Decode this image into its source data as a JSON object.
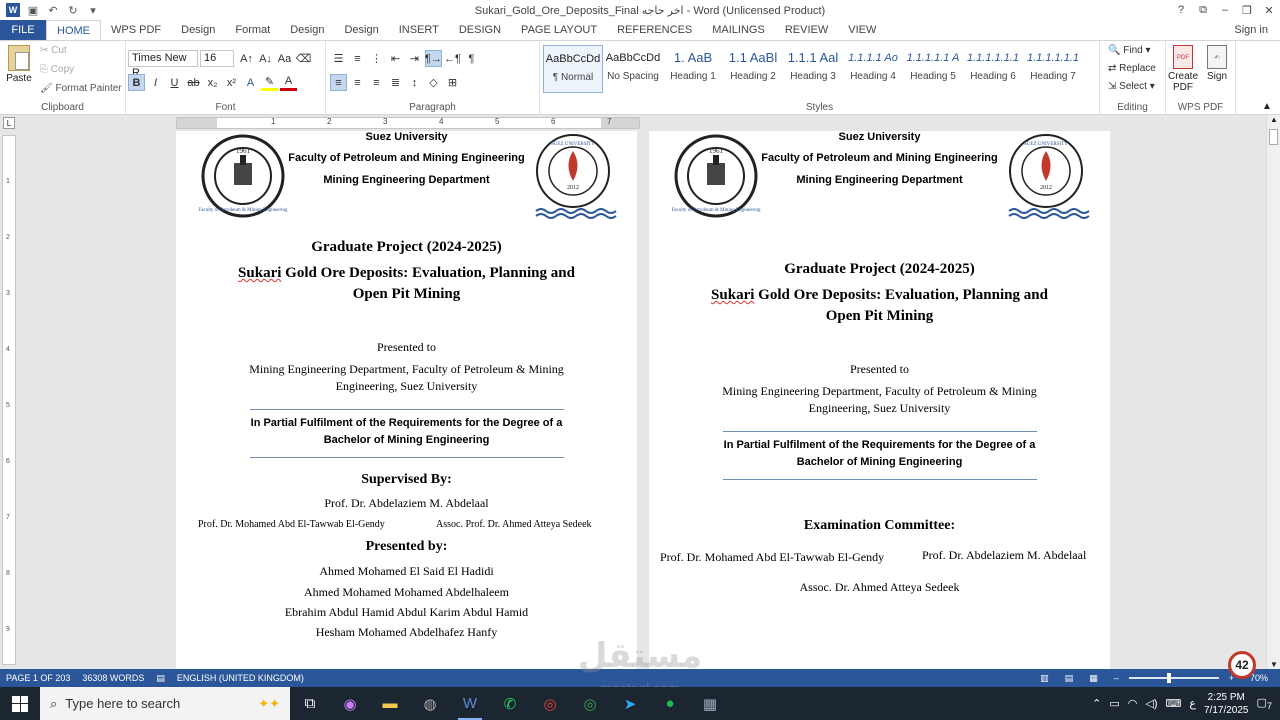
{
  "window": {
    "title": "Sukari_Gold_Ore_Deposits_Final اخر حاجه - Word (Unlicensed Product)",
    "controls": [
      "?",
      "⧉",
      "–",
      "❐",
      "✕"
    ]
  },
  "qat": {
    "save_icon": "save-icon",
    "undo_icon": "undo-icon",
    "redo_icon": "redo-icon"
  },
  "tabs": [
    "FILE",
    "HOME",
    "WPS PDF",
    "Design",
    "Format",
    "Design",
    "Design",
    "INSERT",
    "DESIGN",
    "PAGE LAYOUT",
    "REFERENCES",
    "MAILINGS",
    "REVIEW",
    "VIEW"
  ],
  "active_tab": "HOME",
  "signin": "Sign in",
  "clipboard": {
    "paste": "Paste",
    "cut": "Cut",
    "copy": "Copy",
    "format_painter": "Format Painter",
    "label": "Clipboard"
  },
  "font": {
    "name": "Times New R",
    "size": "16",
    "label": "Font"
  },
  "paragraph": {
    "label": "Paragraph"
  },
  "styles": {
    "label": "Styles",
    "items": [
      {
        "sample": "AaBbCcDd",
        "name": "¶ Normal"
      },
      {
        "sample": "AaBbCcDd",
        "name": "No Spacing"
      },
      {
        "sample": "1. AaB",
        "name": "Heading 1"
      },
      {
        "sample": "1.1 AaBl",
        "name": "Heading 2"
      },
      {
        "sample": "1.1.1 Aal",
        "name": "Heading 3"
      },
      {
        "sample": "1.1.1.1 Ao",
        "name": "Heading 4"
      },
      {
        "sample": "1.1.1.1.1 A",
        "name": "Heading 5"
      },
      {
        "sample": "1.1.1.1.1.1",
        "name": "Heading 6"
      },
      {
        "sample": "1.1.1.1.1.1",
        "name": "Heading 7"
      }
    ]
  },
  "editing": {
    "find": "Find",
    "replace": "Replace",
    "select": "Select",
    "label": "Editing"
  },
  "wps": {
    "create_pdf_1": "Create",
    "create_pdf_2": "PDF",
    "sign": "Sign",
    "label": "WPS PDF"
  },
  "ruler": {
    "numbers": [
      "1",
      "2",
      "3",
      "4",
      "5",
      "6",
      "7"
    ],
    "vnumbers": [
      "1",
      "2",
      "3",
      "4",
      "5",
      "6",
      "7",
      "8",
      "9"
    ]
  },
  "page1": {
    "univ": "Suez University",
    "faculty": "Faculty of Petroleum and Mining Engineering",
    "dept": "Mining Engineering Department",
    "project": "Graduate Project (2024-2025)",
    "title_sukari": "Sukari",
    "title_rest1": " Gold Ore Deposits: Evaluation, Planning and",
    "title_line2": "Open Pit Mining",
    "presented_to": "Presented to",
    "pt1": "Mining Engineering Department, Faculty of Petroleum & Mining",
    "pt2": "Engineering, Suez University",
    "fulfil1": "In Partial Fulfilment of the Requirements for the Degree of a",
    "fulfil2": "Bachelor of Mining Engineering",
    "supervised": "Supervised By:",
    "sup1": "Prof. Dr. Abdelaziem M. Abdelaal",
    "sup2": "Prof. Dr. Mohamed Abd El-Tawwab El-Gendy",
    "sup3": "Assoc. Prof. Dr. Ahmed Atteya Sedeek",
    "presented_by": "Presented by:",
    "students": [
      "Ahmed Mohamed El Said El Hadidi",
      "Ahmed Mohamed Mohamed Abdelhaleem",
      "Ebrahim Abdul Hamid Abdul Karim Abdul Hamid",
      "Hesham Mohamed Abdelhafez Hanfy"
    ]
  },
  "page2": {
    "univ": "Suez University",
    "faculty": "Faculty of Petroleum and Mining Engineering",
    "dept": "Mining Engineering Department",
    "project": "Graduate Project (2024-2025)",
    "title_sukari": "Sukari",
    "title_rest1": " Gold Ore Deposits: Evaluation, Planning and",
    "title_line2": "Open Pit Mining",
    "presented_to": "Presented to",
    "pt1": "Mining Engineering Department, Faculty of Petroleum & Mining",
    "pt2": "Engineering, Suez University",
    "fulfil1": "In Partial Fulfilment of the Requirements for the Degree of a",
    "fulfil2": "Bachelor of Mining Engineering",
    "committee": "Examination Committee:",
    "c1": "Prof. Dr. Mohamed Abd El-Tawwab El-Gendy",
    "c2": "Prof. Dr. Abdelaziem M. Abdelaal",
    "c3": "Assoc. Dr. Ahmed Atteya Sedeek"
  },
  "logos": {
    "left_year": "1961",
    "left_text": "Faculty of Petroleum & Mining Engineering",
    "right_year": "2012",
    "right_text": "SUEZ UNIVERSITY"
  },
  "status": {
    "page": "PAGE 1 OF 203",
    "words": "36308 WORDS",
    "lang": "ENGLISH (UNITED KINGDOM)",
    "zoom": "70%",
    "zoom_fraction": 0.45
  },
  "badge": "42",
  "watermark": {
    "arabic": "مستقل",
    "latin": "mostaql.com"
  },
  "taskbar": {
    "search": "Type here to search",
    "time": "2:25 PM",
    "date": "7/17/2025",
    "notif": "7"
  }
}
